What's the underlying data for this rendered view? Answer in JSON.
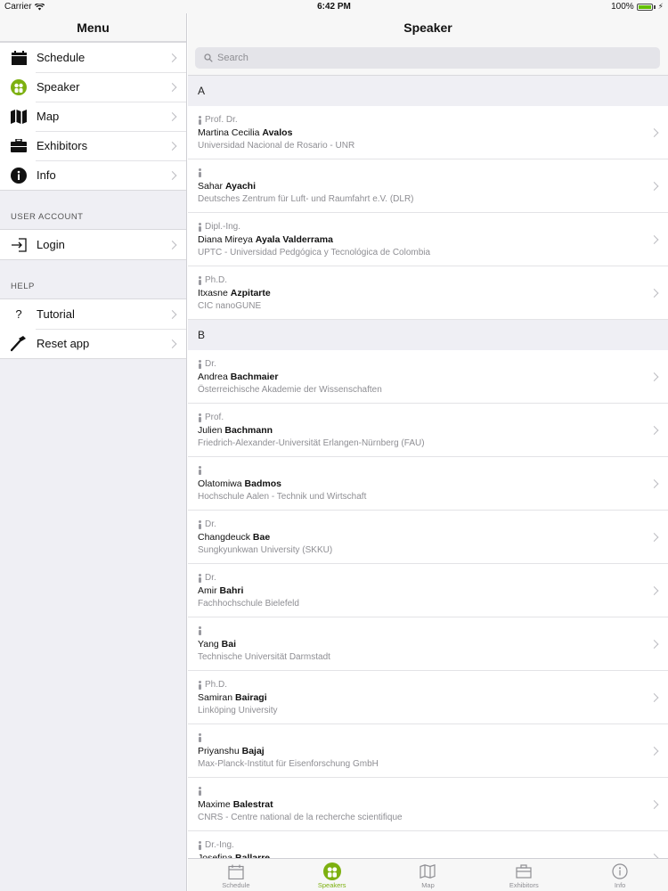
{
  "status_bar": {
    "carrier": "Carrier",
    "time": "6:42 PM",
    "battery": "100%"
  },
  "sidebar": {
    "title": "Menu",
    "items": [
      {
        "label": "Schedule",
        "icon": "calendar-icon"
      },
      {
        "label": "Speaker",
        "icon": "speaker-icon"
      },
      {
        "label": "Map",
        "icon": "map-icon"
      },
      {
        "label": "Exhibitors",
        "icon": "briefcase-icon"
      },
      {
        "label": "Info",
        "icon": "info-icon"
      }
    ],
    "user_account": {
      "header": "USER ACCOUNT",
      "items": [
        {
          "label": "Login",
          "icon": "login-icon"
        }
      ]
    },
    "help": {
      "header": "HELP",
      "items": [
        {
          "label": "Tutorial",
          "icon": "question-icon",
          "glyph": "?"
        },
        {
          "label": "Reset app",
          "icon": "hammer-icon"
        }
      ]
    }
  },
  "main": {
    "title": "Speaker",
    "search_placeholder": "Search",
    "sections": [
      {
        "letter": "A",
        "speakers": [
          {
            "title": "Prof. Dr.",
            "first": "Martina Cecilia",
            "last": "Avalos",
            "org": "Universidad Nacional de Rosario - UNR"
          },
          {
            "title": "",
            "first": "Sahar",
            "last": "Ayachi",
            "org": "Deutsches Zentrum für Luft- und Raumfahrt e.V. (DLR)"
          },
          {
            "title": "Dipl.-Ing.",
            "first": "Diana Mireya",
            "last": "Ayala Valderrama",
            "org": "UPTC - Universidad Pedgógica y Tecnológica de Colombia"
          },
          {
            "title": "Ph.D.",
            "first": "Itxasne",
            "last": "Azpitarte",
            "org": "CIC nanoGUNE"
          }
        ]
      },
      {
        "letter": "B",
        "speakers": [
          {
            "title": "Dr.",
            "first": "Andrea",
            "last": "Bachmaier",
            "org": "Österreichische Akademie der Wissenschaften"
          },
          {
            "title": "Prof.",
            "first": "Julien",
            "last": "Bachmann",
            "org": "Friedrich-Alexander-Universität Erlangen-Nürnberg (FAU)"
          },
          {
            "title": "",
            "first": "Olatomiwa",
            "last": "Badmos",
            "org": "Hochschule Aalen - Technik und Wirtschaft"
          },
          {
            "title": "Dr.",
            "first": "Changdeuck",
            "last": "Bae",
            "org": "Sungkyunkwan University (SKKU)"
          },
          {
            "title": "Dr.",
            "first": "Amir",
            "last": "Bahri",
            "org": "Fachhochschule Bielefeld"
          },
          {
            "title": "",
            "first": "Yang",
            "last": "Bai",
            "org": "Technische Universität Darmstadt"
          },
          {
            "title": "Ph.D.",
            "first": "Samiran",
            "last": "Bairagi",
            "org": "Linköping University"
          },
          {
            "title": "",
            "first": "Priyanshu",
            "last": "Bajaj",
            "org": "Max-Planck-Institut für Eisenforschung GmbH"
          },
          {
            "title": "",
            "first": "Maxime",
            "last": "Balestrat",
            "org": "CNRS - Centre national de la recherche scientifique"
          },
          {
            "title": "Dr.-Ing.",
            "first": "Josefina",
            "last": "Ballarre",
            "org": ""
          }
        ]
      }
    ]
  },
  "tabbar": {
    "tabs": [
      {
        "label": "Schedule",
        "icon": "calendar-icon"
      },
      {
        "label": "Speakers",
        "icon": "speaker-icon",
        "active": true
      },
      {
        "label": "Map",
        "icon": "map-icon"
      },
      {
        "label": "Exhibitors",
        "icon": "briefcase-icon"
      },
      {
        "label": "Info",
        "icon": "info-icon"
      }
    ]
  },
  "colors": {
    "accent": "#7db010",
    "background": "#efeff4",
    "secondary_text": "#8e8e93"
  }
}
